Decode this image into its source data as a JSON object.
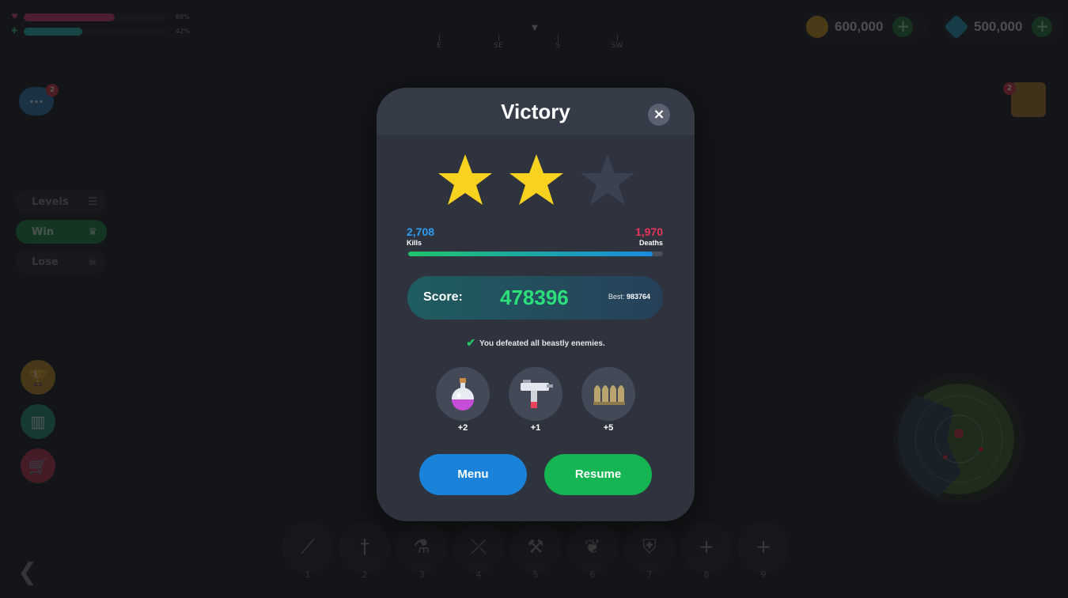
{
  "hud": {
    "health_pct": "88%",
    "energy_pct": "42%",
    "health_fill": 0.64,
    "energy_fill": 0.41,
    "compass": [
      "E",
      "SE",
      "S",
      "SW"
    ],
    "coins": "600,000",
    "gems": "500,000",
    "plus": "+",
    "chat_badge": "2",
    "chat_dots": "...",
    "map_badge": "2",
    "menu_items": [
      {
        "label": "Levels",
        "icon": "list-icon"
      },
      {
        "label": "Win",
        "icon": "crown-icon"
      },
      {
        "label": "Lose",
        "icon": "skull-icon"
      }
    ],
    "side_buttons": [
      "trophy-icon",
      "stats-icon",
      "cart-icon"
    ],
    "back": "back-arrow-icon",
    "hotbar": [
      {
        "num": "1",
        "icon": "rifle-icon"
      },
      {
        "num": "2",
        "icon": "dagger-icon"
      },
      {
        "num": "3",
        "icon": "potion-icon"
      },
      {
        "num": "4",
        "icon": "crossbow-icon"
      },
      {
        "num": "5",
        "icon": "axe-icon"
      },
      {
        "num": "6",
        "icon": "leaf-icon"
      },
      {
        "num": "7",
        "icon": "shield-icon"
      },
      {
        "num": "8",
        "icon": "plus-icon"
      },
      {
        "num": "9",
        "icon": "plus-icon"
      }
    ]
  },
  "modal": {
    "title": "Victory",
    "close": "×",
    "stars_earned": 2,
    "stars_total": 3,
    "kills_value": "2,708",
    "kills_label": "Kills",
    "deaths_value": "1,970",
    "deaths_label": "Deaths",
    "kd_fill": 0.96,
    "score_label": "Score:",
    "score_value": "478396",
    "best_label": "Best:",
    "best_value": "983764",
    "objective": "You defeated all beastly enemies.",
    "rewards": [
      {
        "icon": "potion-icon",
        "count": "+2"
      },
      {
        "icon": "uzi-icon",
        "count": "+1"
      },
      {
        "icon": "ammo-icon",
        "count": "+5"
      }
    ],
    "menu_button": "Menu",
    "resume_button": "Resume"
  },
  "colors": {
    "kills": "#2d9cf0",
    "deaths": "#e8335a",
    "star_on": "#f7d21e",
    "star_off": "#3a4150",
    "score": "#2cdf7a"
  }
}
